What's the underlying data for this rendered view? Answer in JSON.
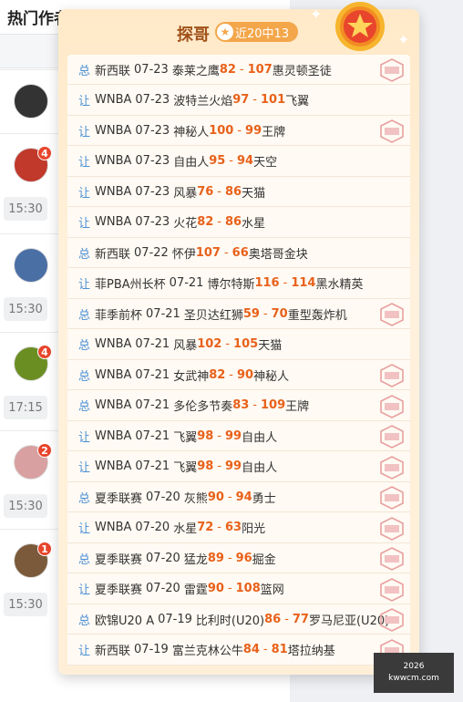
{
  "background": {
    "title": "热门作者",
    "rows": [
      {
        "badge": "",
        "time": ""
      },
      {
        "badge": "4",
        "time": "15:30"
      },
      {
        "badge": "",
        "time": "15:30"
      },
      {
        "badge": "4",
        "time": "17:15"
      },
      {
        "badge": "2",
        "time": "15:30"
      },
      {
        "badge": "1",
        "time": "15:30"
      }
    ]
  },
  "popup": {
    "title": "探哥",
    "record": "近20中13",
    "stamp_icon": "hit-stamp-icon",
    "rows": [
      {
        "type": "总",
        "league": "新西联",
        "date": "07-23",
        "home": "泰莱之鹰",
        "hs": "82",
        "as": "107",
        "away": "惠灵顿圣徒",
        "hit": true
      },
      {
        "type": "让",
        "league": "WNBA",
        "date": "07-23",
        "home": "波特兰火焰",
        "hs": "97",
        "as": "101",
        "away": "飞翼",
        "hit": false
      },
      {
        "type": "让",
        "league": "WNBA",
        "date": "07-23",
        "home": "神秘人",
        "hs": "100",
        "as": "99",
        "away": "王牌",
        "hit": true
      },
      {
        "type": "让",
        "league": "WNBA",
        "date": "07-23",
        "home": "自由人",
        "hs": "95",
        "as": "94",
        "away": "天空",
        "hit": false
      },
      {
        "type": "让",
        "league": "WNBA",
        "date": "07-23",
        "home": "风暴",
        "hs": "76",
        "as": "86",
        "away": "天猫",
        "hit": false
      },
      {
        "type": "让",
        "league": "WNBA",
        "date": "07-23",
        "home": "火花",
        "hs": "82",
        "as": "86",
        "away": "水星",
        "hit": false
      },
      {
        "type": "总",
        "league": "新西联",
        "date": "07-22",
        "home": "怀伊",
        "hs": "107",
        "as": "66",
        "away": "奥塔哥金块",
        "hit": false
      },
      {
        "type": "让",
        "league": "菲PBA州长杯",
        "date": "07-21",
        "home": "博尔特斯",
        "hs": "116",
        "as": "114",
        "away": "黑水精英",
        "hit": false
      },
      {
        "type": "总",
        "league": "菲季前杯",
        "date": "07-21",
        "home": "圣贝达红狮",
        "hs": "59",
        "as": "70",
        "away": "重型轰炸机",
        "hit": true
      },
      {
        "type": "总",
        "league": "WNBA",
        "date": "07-21",
        "home": "风暴",
        "hs": "102",
        "as": "105",
        "away": "天猫",
        "hit": false
      },
      {
        "type": "总",
        "league": "WNBA",
        "date": "07-21",
        "home": "女武神",
        "hs": "82",
        "as": "90",
        "away": "神秘人",
        "hit": true
      },
      {
        "type": "总",
        "league": "WNBA",
        "date": "07-21",
        "home": "多伦多节奏",
        "hs": "83",
        "as": "109",
        "away": "王牌",
        "hit": true
      },
      {
        "type": "让",
        "league": "WNBA",
        "date": "07-21",
        "home": "飞翼",
        "hs": "98",
        "as": "99",
        "away": "自由人",
        "hit": true
      },
      {
        "type": "让",
        "league": "WNBA",
        "date": "07-21",
        "home": "飞翼",
        "hs": "98",
        "as": "99",
        "away": "自由人",
        "hit": true
      },
      {
        "type": "总",
        "league": "夏季联赛",
        "date": "07-20",
        "home": "灰熊",
        "hs": "90",
        "as": "94",
        "away": "勇士",
        "hit": true
      },
      {
        "type": "让",
        "league": "WNBA",
        "date": "07-20",
        "home": "水星",
        "hs": "72",
        "as": "63",
        "away": "阳光",
        "hit": true
      },
      {
        "type": "总",
        "league": "夏季联赛",
        "date": "07-20",
        "home": "猛龙",
        "hs": "89",
        "as": "96",
        "away": "掘金",
        "hit": true
      },
      {
        "type": "让",
        "league": "夏季联赛",
        "date": "07-20",
        "home": "雷霆",
        "hs": "90",
        "as": "108",
        "away": "篮网",
        "hit": true
      },
      {
        "type": "总",
        "league": "欧锦U20 A",
        "date": "07-19",
        "home": "比利时(U20)",
        "hs": "86",
        "as": "77",
        "away": "罗马尼亚(U20)",
        "hit": true
      },
      {
        "type": "让",
        "league": "新西联",
        "date": "07-19",
        "home": "富兰克林公牛",
        "hs": "84",
        "as": "81",
        "away": "塔拉纳基",
        "hit": true
      }
    ]
  },
  "watermark": {
    "line1": "2026",
    "line2": "kwwcm.com"
  }
}
